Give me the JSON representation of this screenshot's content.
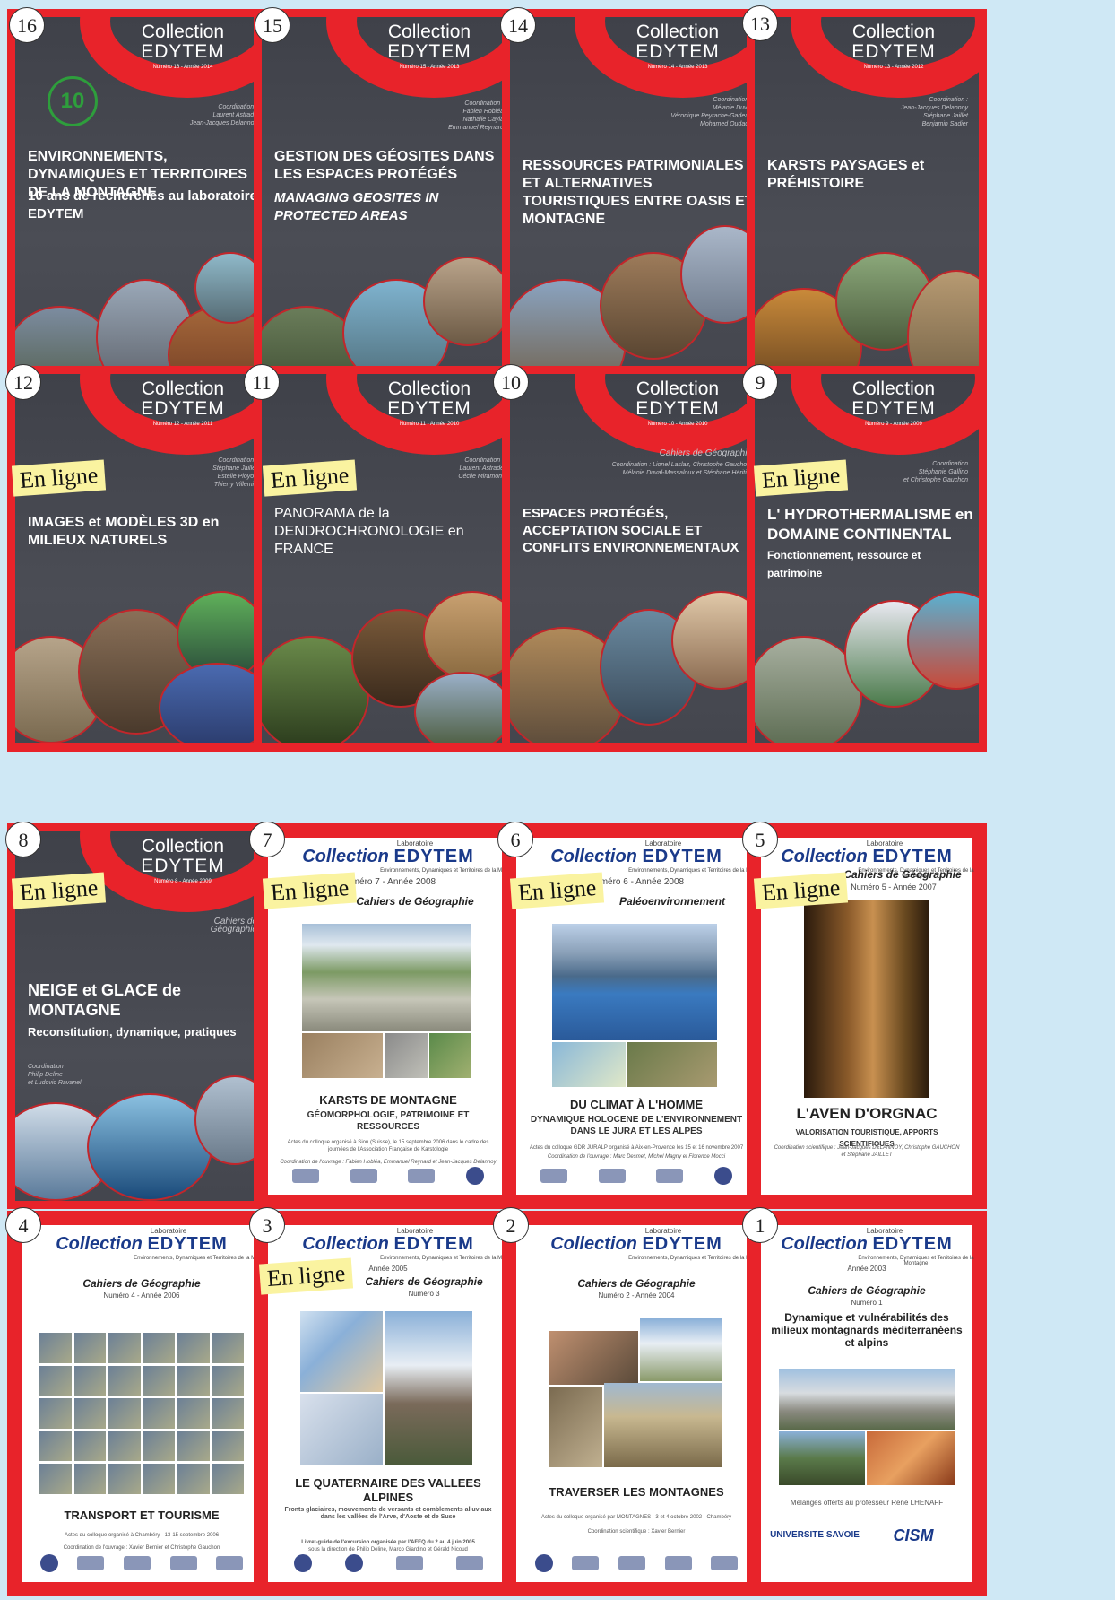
{
  "brand": {
    "line1": "Collection",
    "line2": "EDYTEM",
    "white_collection": "Collection",
    "white_edytem": "EDYTEM",
    "laboratoire": "Laboratoire",
    "lab_full": "Environnements, Dynamiques et Territoires de la Montagne"
  },
  "badge_online": "En ligne",
  "stamp_num": "10",
  "covers": {
    "c16": {
      "num": "16",
      "issue": "Numéro 16 - Année 2014",
      "coord_label": "Coordination :",
      "coord": "Laurent Astrade\nJean-Jacques Delannoy",
      "title": "ENVIRONNEMENTS, DYNAMIQUES ET TERRITOIRES DE LA MONTAGNE",
      "sub": "10 ans de recherches au laboratoire EDYTEM"
    },
    "c15": {
      "num": "15",
      "issue": "Numéro 15 - Année 2013",
      "coord_label": "Coordination :",
      "coord": "Fabien Hobléa\nNathalie Cayla\nEmmanuel Reynard",
      "title": "GESTION DES GÉOSITES DANS LES ESPACES PROTÉGÉS",
      "sub": "MANAGING GEOSITES IN PROTECTED AREAS"
    },
    "c14": {
      "num": "14",
      "issue": "Numéro 14 - Année 2013",
      "coord_label": "Coordination :",
      "coord": "Mélanie Duval\nVéronique Peyrache-Gadeau\nMohamed Oudada",
      "title": "RESSOURCES PATRIMONIALES ET ALTERNATIVES TOURISTIQUES ENTRE OASIS ET MONTAGNE"
    },
    "c13": {
      "num": "13",
      "issue": "Numéro 13 - Année 2012",
      "coord_label": "Coordination :",
      "coord": "Jean-Jacques Delannoy\nStéphane Jaillet\nBenjamin Sadier",
      "title": "KARSTS PAYSAGES et PRÉHISTOIRE"
    },
    "c12": {
      "num": "12",
      "issue": "Numéro 12 - Année 2011",
      "coord_label": "Coordination :",
      "coord": "Stéphane Jaillet\nEstelle Ployon\nThierry Villemin",
      "title": "IMAGES et MODÈLES 3D en MILIEUX NATURELS"
    },
    "c11": {
      "num": "11",
      "issue": "Numéro 11 - Année 2010",
      "coord_label": "Coordination :",
      "coord": "Laurent Astrade\nCécile Miramont",
      "title": "PANORAMA de la DENDROCHRONOLOGIE en FRANCE"
    },
    "c10": {
      "num": "10",
      "issue": "Numéro 10 - Année 2010",
      "series": "Cahiers de Géographie",
      "coord": "Coordination : Lionel Laslaz, Christophe Gauchon,\nMélanie Duval-Massaloux et Stéphane Héritier",
      "title": "ESPACES PROTÉGÉS, ACCEPTATION SOCIALE ET CONFLITS ENVIRONNEMENTAUX"
    },
    "c9": {
      "num": "9",
      "issue": "Numéro 9 - Année 2009",
      "coord_label": "Coordination",
      "coord": "Stéphanie Gallino\net Christophe Gauchon",
      "title": "L' HYDROTHERMALISME en DOMAINE CONTINENTAL",
      "sub": "Fonctionnement, ressource et patrimoine"
    },
    "c8": {
      "num": "8",
      "issue": "Numéro 8 - Année 2009",
      "series": "Cahiers de Géographie",
      "coord": "Coordination\nPhilip Deline\net Ludovic Ravanel",
      "title": "NEIGE et GLACE de MONTAGNE",
      "sub": "Reconstitution, dynamique, pratiques"
    },
    "c7": {
      "num": "7",
      "issue": "Numéro 7 - Année 2008",
      "series": "Cahiers de Géographie",
      "title": "KARSTS DE MONTAGNE",
      "sub": "GÉOMORPHOLOGIE, PATRIMOINE ET RESSOURCES",
      "tiny": "Actes du colloque organisé à Sion (Suisse), le 15 septembre 2006 dans le cadre des journées de l'Association Française de Karstologie",
      "tiny2": "Coordination de l'ouvrage : Fabien Hobléa, Emmanuel Reynard et Jean-Jacques Delannoy"
    },
    "c6": {
      "num": "6",
      "issue": "Numéro 6 - Année 2008",
      "series": "Paléoenvironnement",
      "title": "DU CLIMAT À L'HOMME",
      "sub": "DYNAMIQUE HOLOCENE DE L'ENVIRONNEMENT DANS LE JURA ET LES ALPES",
      "tiny": "Actes du colloque GDR JURALP organisé à Aix-en-Provence les 15 et 16 novembre 2007",
      "tiny2": "Coordination de l'ouvrage : Marc Desmet, Michel Magny et Florence Mocci"
    },
    "c5": {
      "num": "5",
      "issue": "Numéro 5 - Année 2007",
      "series": "Cahiers de Géographie",
      "title": "L'AVEN D'ORGNAC",
      "sub": "VALORISATION TOURISTIQUE, APPORTS SCIENTIFIQUES",
      "tiny": "Coordination scientifique : Jean-Jacques DELANNOY, Christophe GAUCHON et Stéphane JAILLET"
    },
    "c4": {
      "num": "4",
      "issue": "Numéro 4 - Année 2006",
      "series": "Cahiers de Géographie",
      "title": "TRANSPORT ET TOURISME",
      "tiny": "Actes du colloque organisé à Chambéry - 13-15 septembre 2006",
      "tiny2": "Coordination de l'ouvrage : Xavier Bernier et Christophe Gauchon"
    },
    "c3": {
      "num": "3",
      "issue": "Année 2005",
      "series": "Cahiers de Géographie",
      "issue2": "Numéro 3",
      "title": "LE QUATERNAIRE DES VALLEES ALPINES",
      "sub": "Fronts glaciaires, mouvements de versants et comblements alluviaux dans les vallées de l'Arve, d'Aoste et de Suse",
      "tiny": "Livret-guide de l'excursion organisée par l'AFEQ du 2 au 4 juin 2005",
      "tiny2": "sous la direction de Philip Deline, Marco Giardino et Gérald Nicoud"
    },
    "c2": {
      "num": "2",
      "issue": "Numéro 2 - Année 2004",
      "series": "Cahiers de Géographie",
      "title": "TRAVERSER LES MONTAGNES",
      "tiny": "Actes du colloque organisé par MONTAGNES - 3 et 4 octobre 2002 - Chambéry",
      "tiny2": "Coordination scientifique : Xavier Bernier"
    },
    "c1": {
      "num": "1",
      "issue": "Année 2003",
      "series": "Cahiers de Géographie",
      "issue2": "Numéro 1",
      "title": "Dynamique et vulnérabilités des milieux montagnards méditerranéens et alpins",
      "tiny": "Mélanges offerts au professeur René LHENAFF",
      "logo1": "UNIVERSITE SAVOIE",
      "logo2": "CISM"
    }
  },
  "colors": {
    "red": "#e8232a",
    "dark": "#45474f",
    "background": "#cfe8f5",
    "tag": "#faf3a0",
    "navy": "#1a3a8a"
  }
}
